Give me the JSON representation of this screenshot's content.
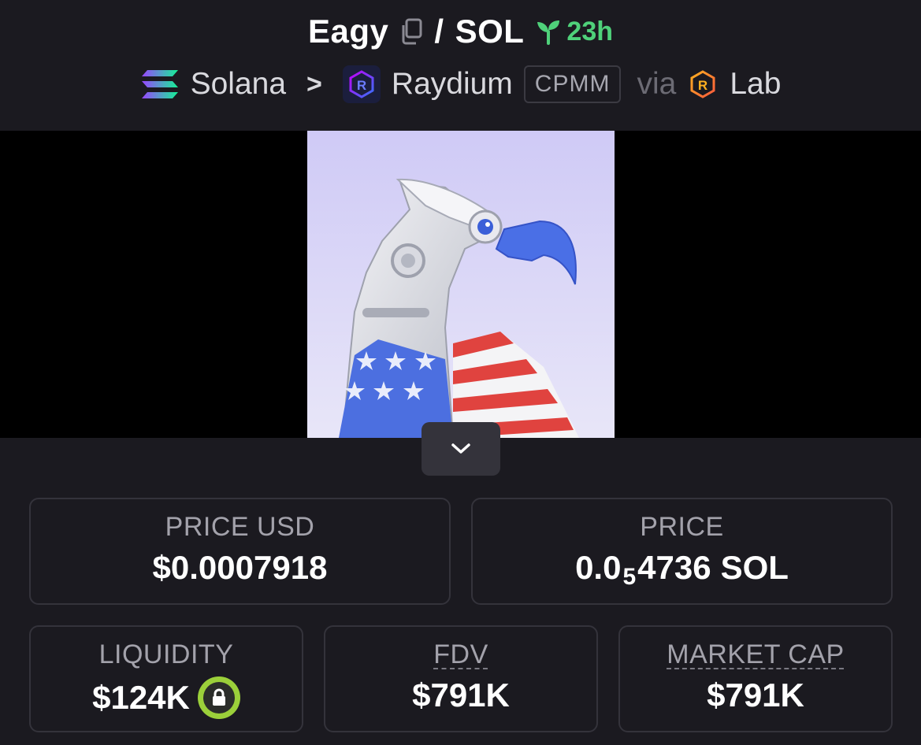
{
  "header": {
    "token_name": "Eagy",
    "slash": "/",
    "quote": "SOL",
    "age": "23h",
    "chain": "Solana",
    "separator": ">",
    "dex": "Raydium",
    "pool_type": "CPMM",
    "via": "via",
    "launchpad": "Lab"
  },
  "icons": {
    "copy": "copy-icon",
    "age": "seedling-icon",
    "chain": "solana-icon",
    "dex": "raydium-icon",
    "launchpad": "raydium-lab-icon",
    "expand": "chevron-down-icon",
    "lock": "lock-icon"
  },
  "colors": {
    "background": "#1b1a20",
    "age_green": "#4fd17a",
    "lock_ring": "#9bd03a",
    "card_border": "#34333b"
  },
  "stats": {
    "price_usd": {
      "label": "PRICE USD",
      "value": "$0.0007918"
    },
    "price_native": {
      "label": "PRICE",
      "prefix": "0.0",
      "zero_count": "5",
      "digits": "4736",
      "unit": "SOL"
    },
    "liquidity": {
      "label": "LIQUIDITY",
      "value": "$124K"
    },
    "fdv": {
      "label": "FDV",
      "value": "$791K"
    },
    "market_cap": {
      "label": "MARKET CAP",
      "value": "$791K"
    }
  }
}
